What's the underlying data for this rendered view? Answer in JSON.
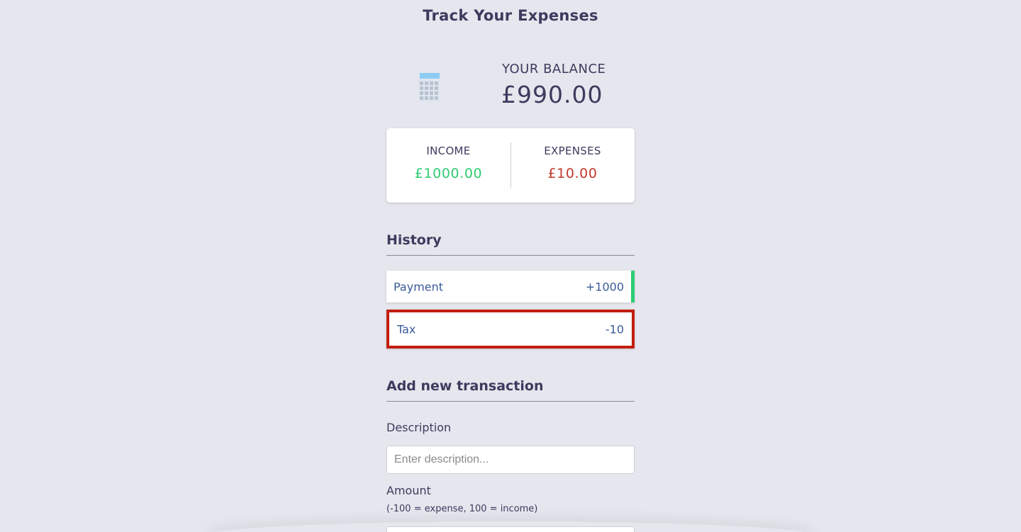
{
  "app": {
    "title": "Track Your Expenses"
  },
  "balance": {
    "label": "YOUR BALANCE",
    "amount": "£990.00",
    "icon": "calculator-icon"
  },
  "summary": {
    "income_label": "INCOME",
    "income_value": "£1000.00",
    "expenses_label": "EXPENSES",
    "expenses_value": "£10.00"
  },
  "history": {
    "heading": "History",
    "items": [
      {
        "text": "Payment",
        "amount": "+1000",
        "type": "income"
      },
      {
        "text": "Tax",
        "amount": "-10",
        "type": "expense",
        "highlighted": true
      }
    ]
  },
  "add_transaction": {
    "heading": "Add new transaction",
    "description_label": "Description",
    "description_placeholder": "Enter description...",
    "amount_label": "Amount",
    "amount_hint": "(-100 = expense, 100 = income)"
  },
  "colors": {
    "background": "#e6e6ee",
    "text": "#3c3b5e",
    "income": "#2ecc71",
    "expense": "#c0392b",
    "history_text": "#3a5a9b",
    "highlight_border": "#c21e0e"
  }
}
